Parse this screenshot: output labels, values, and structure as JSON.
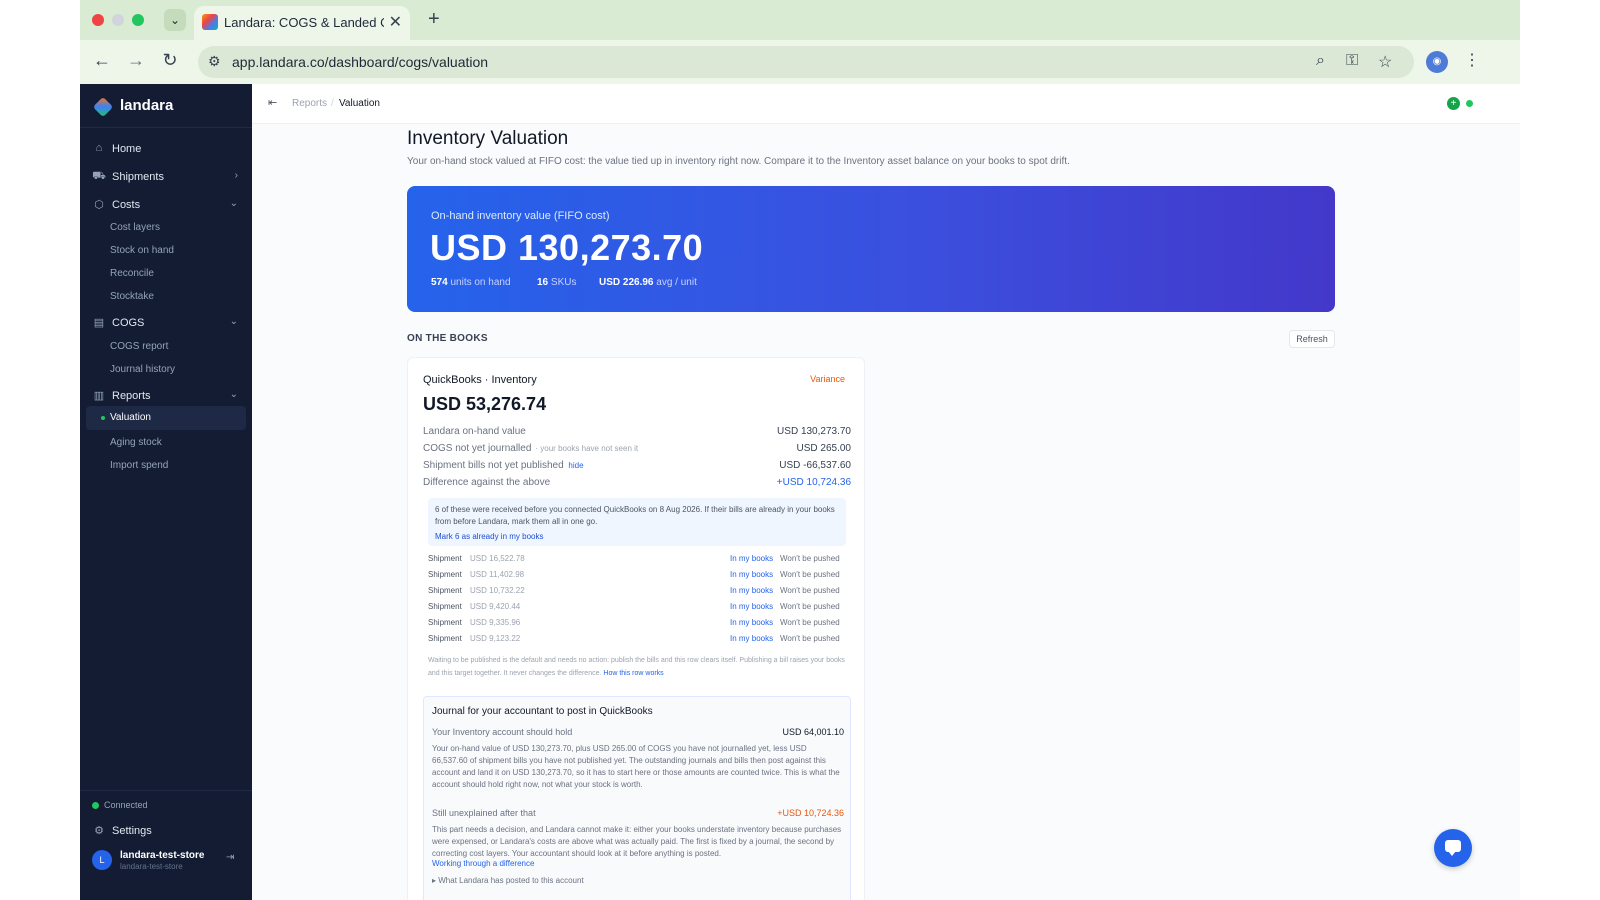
{
  "browser": {
    "tab_title": "Landara: COGS & Landed Co",
    "tab_close": "✕",
    "tab_new": "+",
    "url": "app.landara.co/dashboard/cogs/valuation"
  },
  "sidebar": {
    "brand": "landara",
    "items": {
      "home": "Home",
      "shipments": "Shipments",
      "costs": "Costs",
      "cogs": "COGS",
      "reports": "Reports"
    },
    "costs_sub": [
      "Cost layers",
      "Stock on hand",
      "Reconcile",
      "Stocktake"
    ],
    "cogs_sub": [
      "COGS report",
      "Journal history"
    ],
    "reports_sub": [
      "Valuation",
      "Aging stock",
      "Import spend"
    ],
    "connected": "Connected",
    "settings": "Settings",
    "user": {
      "initial": "L",
      "name": "landara-test-store",
      "handle": "landara-test-store"
    }
  },
  "topbar": {
    "collapse": "⇤",
    "breadcrumb": [
      "Reports",
      "/",
      "Valuation"
    ],
    "status_icon": "+"
  },
  "page": {
    "title": "Inventory Valuation",
    "subtitle": "Your on-hand stock valued at FIFO cost: the value tied up in inventory right now. Compare it to the Inventory asset balance on your books to spot drift."
  },
  "hero": {
    "label": "On-hand inventory value (FIFO cost)",
    "value": "USD 130,273.70",
    "units_count": "574",
    "units_label": "units on hand",
    "skus_count": "16",
    "skus_label": "SKUs",
    "avg_value": "USD 226.96",
    "avg_label": "avg / unit"
  },
  "books": {
    "section_label": "ON THE BOOKS",
    "refresh": "Refresh",
    "card_title": "QuickBooks · Inventory",
    "badge": "Variance",
    "value": "USD 53,276.74",
    "rows": [
      {
        "label": "Landara on-hand value",
        "note": "",
        "link": "",
        "value": "USD 130,273.70"
      },
      {
        "label": "COGS not yet journalled",
        "note": "· your books have not seen it",
        "link": "",
        "value": "USD 265.00"
      },
      {
        "label": "Shipment bills not yet published",
        "note": "",
        "link": "hide",
        "value": "USD -66,537.60"
      },
      {
        "label": "Difference against the above",
        "note": "",
        "link": "",
        "value": "+USD 10,724.36"
      }
    ],
    "notice_text": "6 of these were received before you connected QuickBooks on 8 Aug 2026. If their bills are already in your books from before Landara, mark them all in one go.",
    "notice_link": "Mark 6 as already in my books",
    "shipments": [
      {
        "label": "Shipment",
        "amount": "USD 16,522.78",
        "link": "In my books",
        "status": "Won't be pushed"
      },
      {
        "label": "Shipment",
        "amount": "USD 11,402.98",
        "link": "In my books",
        "status": "Won't be pushed"
      },
      {
        "label": "Shipment",
        "amount": "USD 10,732.22",
        "link": "In my books",
        "status": "Won't be pushed"
      },
      {
        "label": "Shipment",
        "amount": "USD 9,420.44",
        "link": "In my books",
        "status": "Won't be pushed"
      },
      {
        "label": "Shipment",
        "amount": "USD 9,335.96",
        "link": "In my books",
        "status": "Won't be pushed"
      },
      {
        "label": "Shipment",
        "amount": "USD 9,123.22",
        "link": "In my books",
        "status": "Won't be pushed"
      }
    ],
    "footnote": "Waiting to be published is the default and needs no action: publish the bills and this row clears itself. Publishing a bill raises your books and this target together. It never changes the difference.",
    "footnote_link": "How this row works"
  },
  "journal": {
    "title": "Journal for your accountant to post in QuickBooks",
    "row1_label": "Your Inventory account should hold",
    "row1_value": "USD 64,001.10",
    "row1_body": "Your on-hand value of USD 130,273.70, plus USD 265.00 of COGS you have not journalled yet, less USD 66,537.60 of shipment bills you have not published yet. The outstanding journals and bills then post against this account and land it on USD 130,273.70, so it has to start here or those amounts are counted twice. This is what the account should hold right now, not what your stock is worth.",
    "row2_label": "Still unexplained after that",
    "row2_value": "+USD 10,724.36",
    "row2_body": "This part needs a decision, and Landara cannot make it: either your books understate inventory because purchases were expensed, or Landara's costs are above what was actually paid. The first is fixed by a journal, the second by correcting cost layers. Your accountant should look at it before anything is posted.",
    "row2_link": "Working through a difference",
    "collapse": "▸ What Landara has posted to this account"
  },
  "colors": {
    "sidebar_bg": "#131c33",
    "accent": "#2563eb",
    "hero_start": "#2563eb",
    "hero_end": "#4338ca",
    "variance": "#ea580c",
    "success": "#22c55e"
  }
}
